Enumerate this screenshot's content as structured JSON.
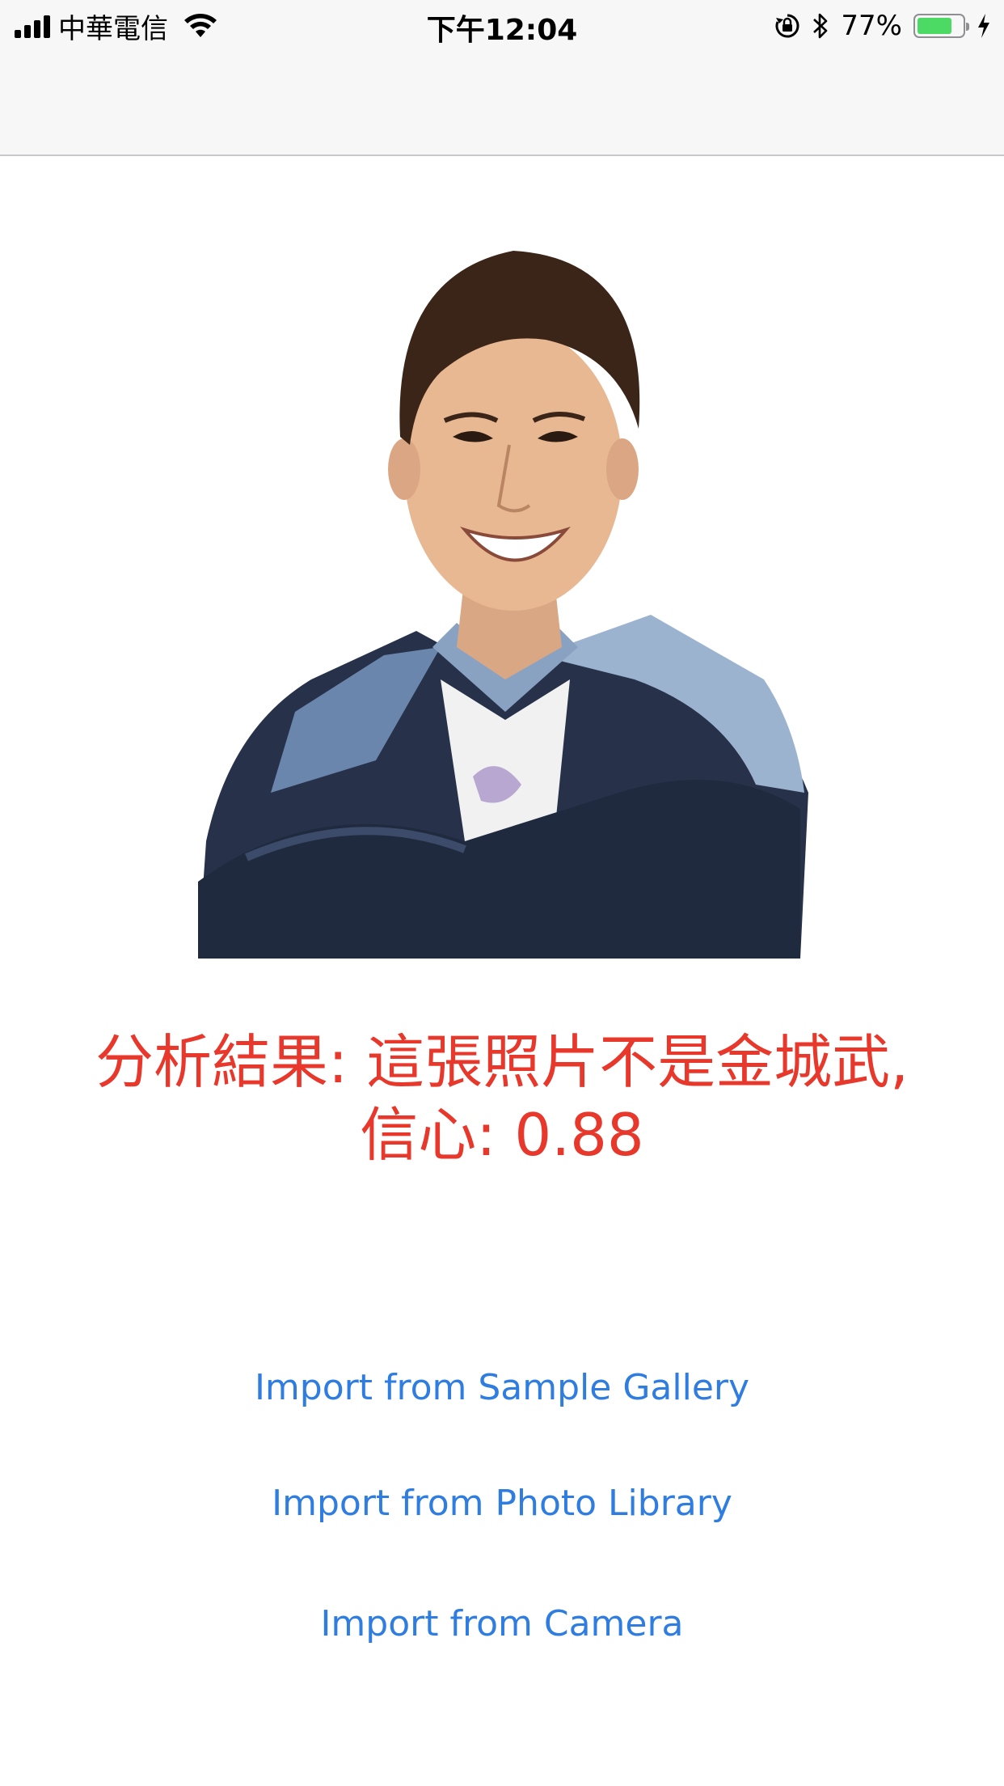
{
  "status_bar": {
    "carrier": "中華電信",
    "time": "下午12:04",
    "battery_percent": "77%",
    "battery_level": 0.77
  },
  "result": {
    "line1": "分析結果: 這張照片不是金城武,",
    "line2": "信心: 0.88"
  },
  "buttons": {
    "sample_gallery": "Import from Sample Gallery",
    "photo_library": "Import from Photo Library",
    "camera": "Import from Camera"
  },
  "colors": {
    "result_text": "#e8372b",
    "link": "#2f7de1",
    "battery_fill": "#4cd964"
  }
}
